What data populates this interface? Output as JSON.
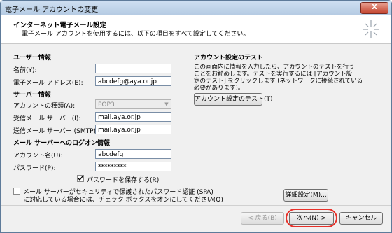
{
  "window": {
    "title": "電子メール アカウントの変更",
    "close_glyph": "X"
  },
  "header": {
    "title": "インターネット電子メール設定",
    "subtitle": "電子メール アカウントを使用するには、以下の項目をすべて設定してください。",
    "icon": "wizard-sparkle-icon"
  },
  "user_info": {
    "heading": "ユーザー情報",
    "name_label": "名前(Y):",
    "name_value": "",
    "email_label": "電子メール アドレス(E):",
    "email_value": "abcdefg@aya.or.jp"
  },
  "server_info": {
    "heading": "サーバー情報",
    "account_type_label": "アカウントの種類(A):",
    "account_type_value": "POP3",
    "incoming_label": "受信メール サーバー(I):",
    "incoming_value": "mail.aya.or.jp",
    "outgoing_label": "送信メール サーバー (SMTP)(O):",
    "outgoing_value": "mail.aya.or.jp"
  },
  "logon_info": {
    "heading": "メール サーバーへのログオン情報",
    "account_label": "アカウント名(U):",
    "account_value": "abcdefg",
    "password_label": "パスワード(P):",
    "password_value": "*********",
    "remember_label": "パスワードを保存する(R)",
    "remember_checked": true,
    "spa_label_1": "メール サーバーがセキュリティで保護されたパスワード認証 (SPA)",
    "spa_label_2": "に対応している場合には、チェック ボックスをオンにしてください(Q)",
    "spa_checked": false
  },
  "test": {
    "heading": "アカウント設定のテスト",
    "desc_1": "この画面内に情報を入力したら、アカウントのテストを行う",
    "desc_2": "ことをお勧めします。テストを実行するには [アカウント設",
    "desc_3": "定のテスト] をクリックします (ネットワークに接続されている",
    "desc_4": "必要があります)。",
    "button_label": "アカウント設定のテスト(T)"
  },
  "advanced_button": "詳細設定(M)...",
  "nav": {
    "back_label": "< 戻る(B)",
    "next_label": "次へ(N) >",
    "cancel_label": "キャンセル"
  },
  "colors": {
    "highlight_ring": "#e8312a",
    "checkmark": "#000000"
  }
}
